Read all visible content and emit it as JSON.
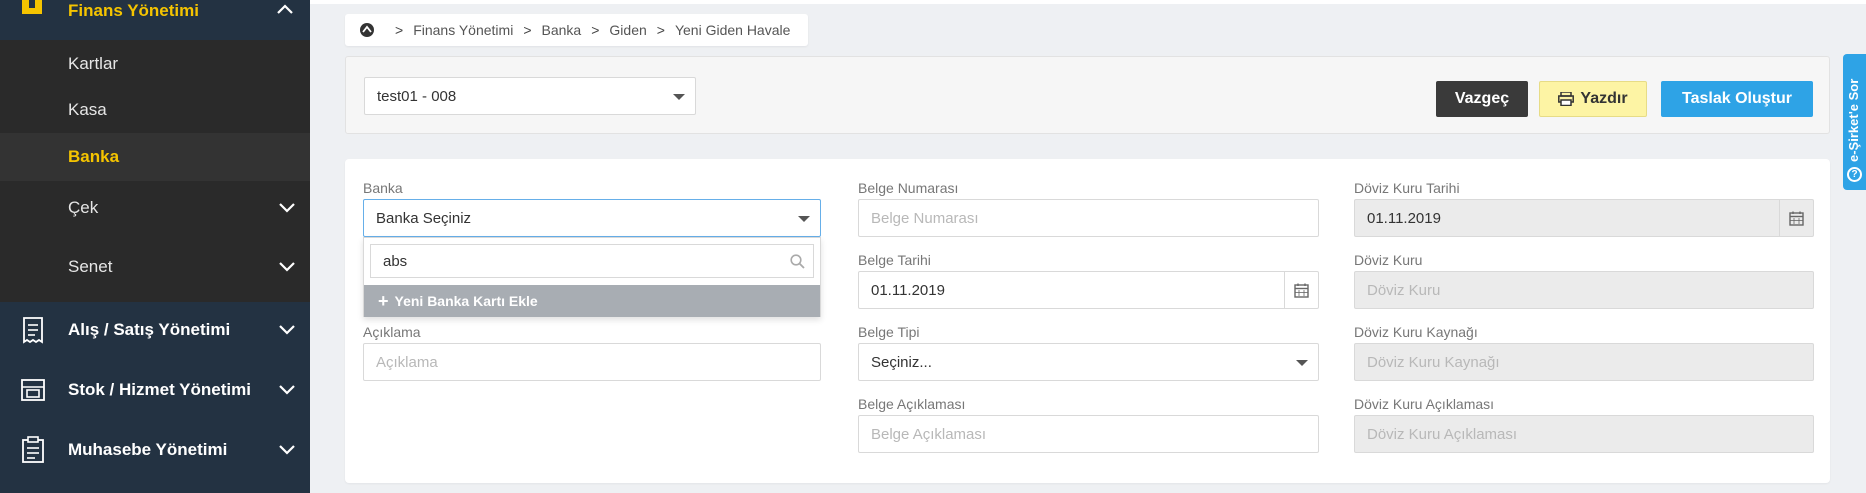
{
  "sidebar": {
    "section_title": "Finans Yönetimi",
    "submenu": [
      {
        "label": "Kartlar"
      },
      {
        "label": "Kasa"
      },
      {
        "label": "Banka"
      },
      {
        "label": "Çek"
      },
      {
        "label": "Senet"
      }
    ],
    "main_items": [
      {
        "label": "Alış / Satış Yönetimi",
        "icon": "receipt-icon"
      },
      {
        "label": "Stok / Hizmet Yönetimi",
        "icon": "stock-icon"
      },
      {
        "label": "Muhasebe Yönetimi",
        "icon": "clipboard-icon"
      }
    ]
  },
  "breadcrumb": [
    "Finans Yönetimi",
    "Banka",
    "Giden",
    "Yeni Giden Havale"
  ],
  "topbar": {
    "company_select": "test01 - 008",
    "cancel_label": "Vazgeç",
    "print_label": "Yazdır",
    "draft_label": "Taslak Oluştur"
  },
  "side_tab": {
    "label": "e-Şirket'e Sor"
  },
  "form": {
    "banka": {
      "label": "Banka",
      "value": "Banka Seçiniz"
    },
    "dropdown": {
      "search_value": "abs",
      "add_label": "Yeni Banka Kartı Ekle"
    },
    "aciklama": {
      "label": "Açıklama",
      "placeholder": "Açıklama"
    },
    "belge_no": {
      "label": "Belge Numarası",
      "placeholder": "Belge Numarası"
    },
    "belge_tarihi": {
      "label": "Belge Tarihi",
      "value": "01.11.2019"
    },
    "belge_tipi": {
      "label": "Belge Tipi",
      "value": "Seçiniz..."
    },
    "belge_aciklama": {
      "label": "Belge Açıklaması",
      "placeholder": "Belge Açıklaması"
    },
    "doviz_tarihi": {
      "label": "Döviz Kuru Tarihi",
      "value": "01.11.2019"
    },
    "doviz_kuru": {
      "label": "Döviz Kuru",
      "placeholder": "Döviz Kuru"
    },
    "doviz_kaynak": {
      "label": "Döviz Kuru Kaynağı",
      "placeholder": "Döviz Kuru Kaynağı"
    },
    "doviz_aciklama": {
      "label": "Döviz Kuru Açıklaması",
      "placeholder": "Döviz Kuru Açıklaması"
    }
  },
  "colors": {
    "accent": "#f5c400",
    "primary": "#2ea3e6",
    "sidebar": "#233242"
  }
}
